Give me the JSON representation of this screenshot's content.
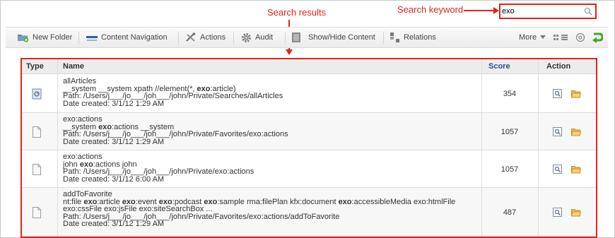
{
  "annotations": {
    "search_results": "Search results",
    "search_keyword": "Search keyword"
  },
  "colors": {
    "annotation": "#e2231a",
    "score_header": "#2b4c8c"
  },
  "search": {
    "value": "exo",
    "icon": "search-icon"
  },
  "toolbar": {
    "new_folder": "New Folder",
    "content_navigation": "Content Navigation",
    "actions": "Actions",
    "audit": "Audit",
    "show_hide": "Show/Hide Content",
    "relations": "Relations",
    "more": "More"
  },
  "table": {
    "headers": {
      "type": "Type",
      "name": "Name",
      "score": "Score",
      "action": "Action"
    },
    "rows": [
      {
        "type_icon": "saved-search-icon",
        "lines": [
          [
            {
              "t": "allArticles",
              "b": false
            }
          ],
          [
            {
              "t": "__system __system xpath //element(*, ",
              "b": false
            },
            {
              "t": "exo",
              "b": true
            },
            {
              "t": ":article)",
              "b": false
            }
          ],
          [
            {
              "t": "Path: /Users/j___/jo___/joh___/john/Private/Searches/allArticles",
              "b": false
            }
          ],
          [
            {
              "t": "Date created: 3/1/12 1:29 AM",
              "b": false
            }
          ]
        ],
        "score": "354"
      },
      {
        "type_icon": "document-icon",
        "lines": [
          [
            {
              "t": "exo:actions",
              "b": false
            }
          ],
          [
            {
              "t": "__system ",
              "b": false
            },
            {
              "t": "exo",
              "b": true
            },
            {
              "t": ":actions __system",
              "b": false
            }
          ],
          [
            {
              "t": "Path: /Users/j___/jo___/joh___/john/Private/Favorites/exo:actions",
              "b": false
            }
          ],
          [
            {
              "t": "Date created: 3/1/12 1:29 AM",
              "b": false
            }
          ]
        ],
        "score": "1057"
      },
      {
        "type_icon": "document-icon",
        "lines": [
          [
            {
              "t": "exo:actions",
              "b": false
            }
          ],
          [
            {
              "t": "john ",
              "b": false
            },
            {
              "t": "exo",
              "b": true
            },
            {
              "t": ":actions john",
              "b": false
            }
          ],
          [
            {
              "t": "Path: /Users/j___/jo___/joh___/john/Private/exo:actions",
              "b": false
            }
          ],
          [
            {
              "t": "Date created: 3/1/12 6:00 AM",
              "b": false
            }
          ]
        ],
        "score": "1057"
      },
      {
        "type_icon": "document-icon",
        "lines": [
          [
            {
              "t": "addToFavorite",
              "b": false
            }
          ],
          [
            {
              "t": "nt:file ",
              "b": false
            },
            {
              "t": "exo",
              "b": true
            },
            {
              "t": ":article ",
              "b": false
            },
            {
              "t": "exo",
              "b": true
            },
            {
              "t": ":event ",
              "b": false
            },
            {
              "t": "exo",
              "b": true
            },
            {
              "t": ":podcast ",
              "b": false
            },
            {
              "t": "exo",
              "b": true
            },
            {
              "t": ":sample rma:filePlan kfx:document ",
              "b": false
            },
            {
              "t": "exo",
              "b": true
            },
            {
              "t": ":accessibleMedia exo:htmlFile",
              "b": false
            }
          ],
          [
            {
              "t": "exo:cssFile exo:jsFile exo:siteSearchBox ...",
              "b": false
            }
          ],
          [
            {
              "t": "Path: /Users/j___/jo___/joh___/john/Private/Favorites/exo:actions/addToFavorite",
              "b": false
            }
          ],
          [
            {
              "t": "Date created: 3/1/12 1:29 AM",
              "b": false
            }
          ]
        ],
        "score": "487"
      }
    ]
  }
}
